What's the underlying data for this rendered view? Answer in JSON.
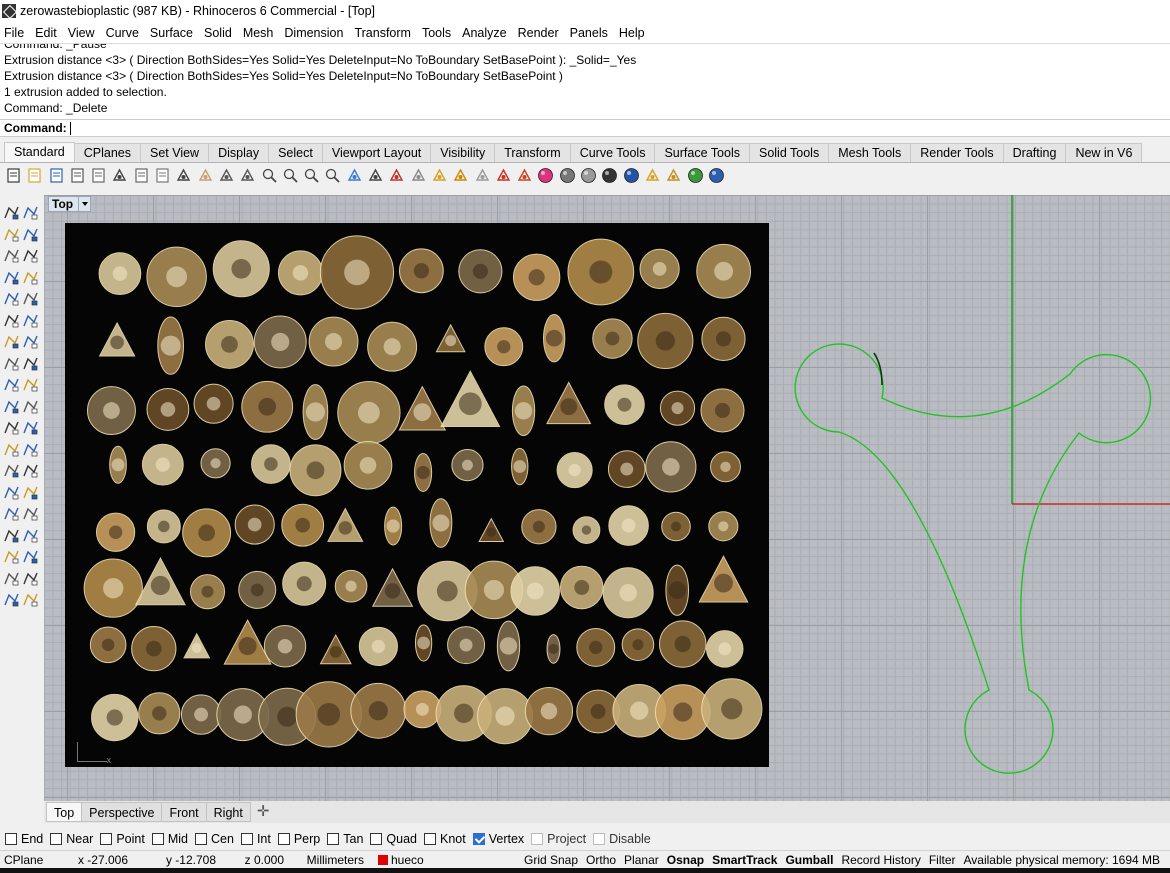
{
  "window": {
    "title": "zerowastebioplastic (987 KB) - Rhinoceros 6 Commercial - [Top]"
  },
  "menu": [
    "File",
    "Edit",
    "View",
    "Curve",
    "Surface",
    "Solid",
    "Mesh",
    "Dimension",
    "Transform",
    "Tools",
    "Analyze",
    "Render",
    "Panels",
    "Help"
  ],
  "history": [
    "Command: _Pause",
    "Extrusion distance <3> ( Direction  BothSides=Yes  Solid=Yes  DeleteInput=No  ToBoundary  SetBasePoint ): _Solid=_Yes",
    "Extrusion distance <3> ( Direction  BothSides=Yes  Solid=Yes  DeleteInput=No  ToBoundary  SetBasePoint )",
    "1 extrusion added to selection.",
    "Command: _Delete"
  ],
  "command_prompt": {
    "label": "Command:",
    "value": ""
  },
  "toolbar_tabs": [
    "Standard",
    "CPlanes",
    "Set View",
    "Display",
    "Select",
    "Viewport Layout",
    "Visibility",
    "Transform",
    "Curve Tools",
    "Surface Tools",
    "Solid Tools",
    "Mesh Tools",
    "Render Tools",
    "Drafting",
    "New in V6"
  ],
  "active_toolbar_tab": "Standard",
  "toolbar_icons": [
    "new-file-icon",
    "open-file-icon",
    "save-icon",
    "print-icon",
    "import-icon",
    "cut-icon",
    "copy-icon",
    "paste-icon",
    "undo-icon",
    "pan-icon",
    "move-view-icon",
    "rotate-view-icon",
    "zoom-dynamic-icon",
    "zoom-window-icon",
    "zoom-extents-icon",
    "zoom-selected-icon",
    "undo-view-icon",
    "four-viewports-icon",
    "car-icon",
    "select-points-icon",
    "cplane-icon",
    "pan-arrows-icon",
    "lightbulb-icon",
    "toggle-points-icon",
    "layer-icon",
    "material-icon",
    "rendered-sphere-icon",
    "shaded-sphere-icon",
    "ghosted-sphere-icon",
    "render-sphere-icon",
    "analyze-icon",
    "options-gear-icon",
    "plugin-globe-icon",
    "help-icon"
  ],
  "viewport": {
    "label": "Top",
    "axis_x_label": "x"
  },
  "viewport_tabs": [
    "Top",
    "Perspective",
    "Front",
    "Right"
  ],
  "active_viewport_tab": "Top",
  "osnaps": [
    {
      "label": "End",
      "checked": false
    },
    {
      "label": "Near",
      "checked": false
    },
    {
      "label": "Point",
      "checked": false
    },
    {
      "label": "Mid",
      "checked": false
    },
    {
      "label": "Cen",
      "checked": false
    },
    {
      "label": "Int",
      "checked": false
    },
    {
      "label": "Perp",
      "checked": false
    },
    {
      "label": "Tan",
      "checked": false
    },
    {
      "label": "Quad",
      "checked": false
    },
    {
      "label": "Knot",
      "checked": false
    },
    {
      "label": "Vertex",
      "checked": true
    },
    {
      "label": "Project",
      "checked": false,
      "disabled": true
    },
    {
      "label": "Disable",
      "checked": false,
      "disabled": true
    }
  ],
  "status": {
    "cplane": "CPlane",
    "x": "x -27.006",
    "y": "y -12.708",
    "z": "z 0.000",
    "units": "Millimeters",
    "layer": "hueco",
    "layer_color": "#e00000",
    "grid_snap": "Grid Snap",
    "ortho": "Ortho",
    "planar": "Planar",
    "osnap": "Osnap",
    "smarttrack": "SmartTrack",
    "gumball": "Gumball",
    "record_history": "Record History",
    "filter": "Filter",
    "memory": "Available physical memory: 1694 MB"
  },
  "colors": {
    "curve": "#1ec51e",
    "x_axis": "#c0302a",
    "y_axis": "#1b9e1b",
    "viewport_bg": "#b9bcc2"
  }
}
